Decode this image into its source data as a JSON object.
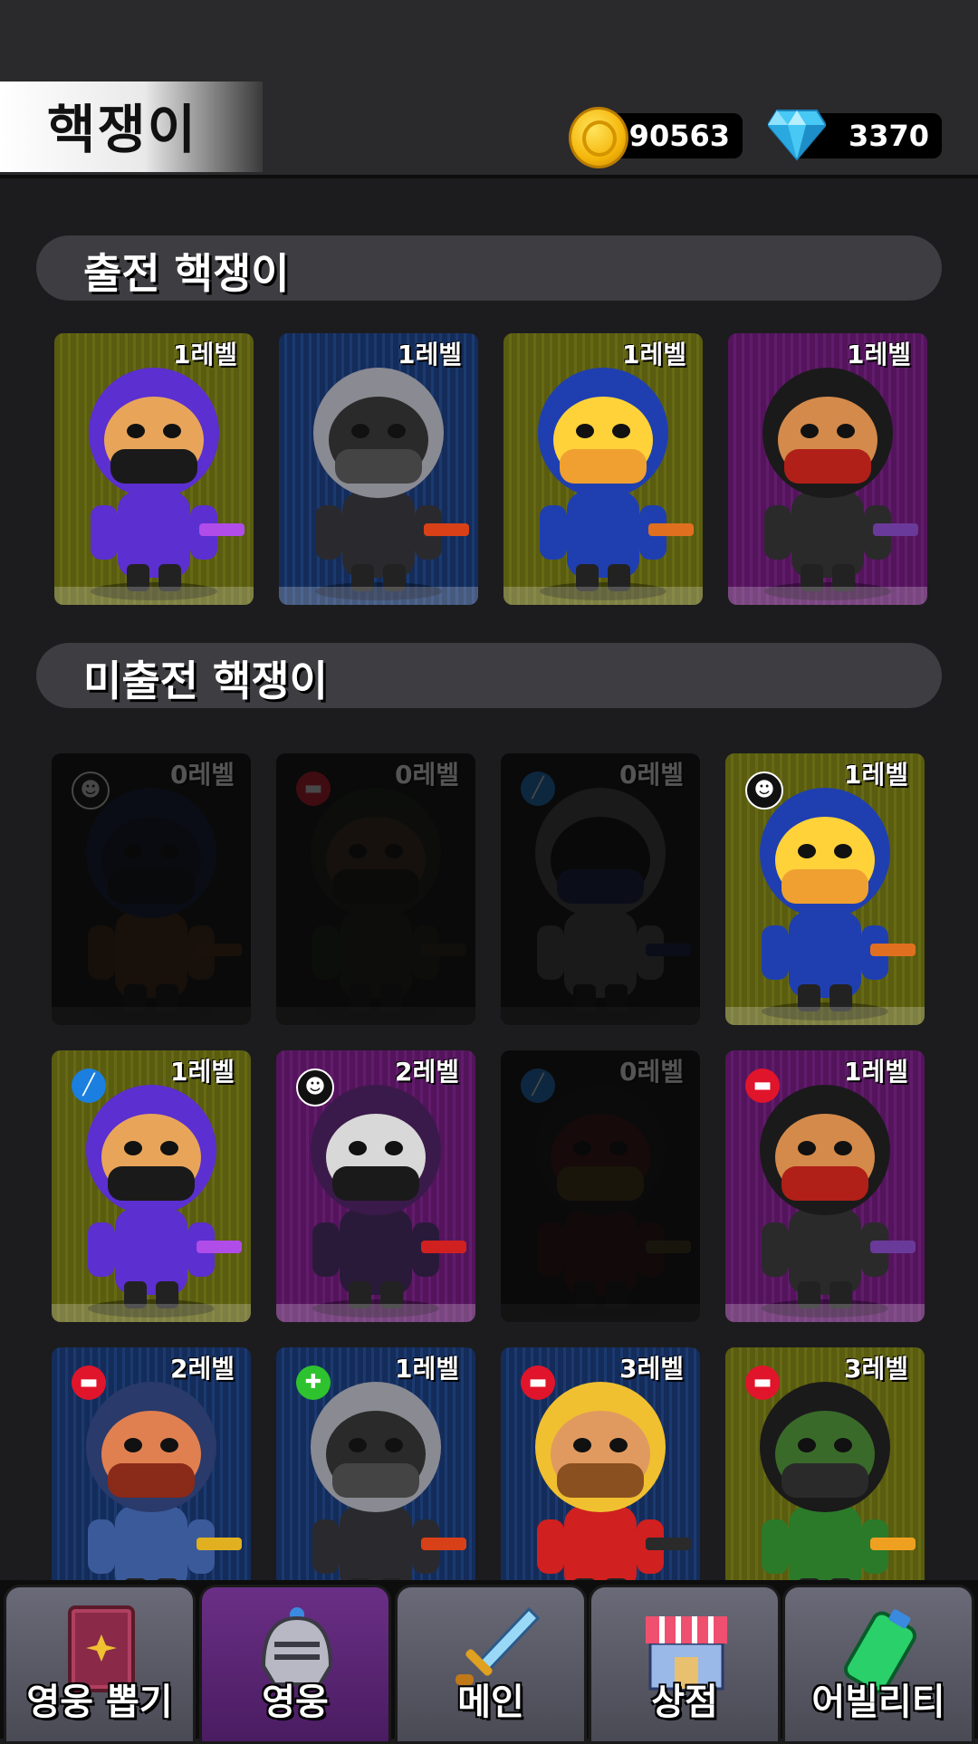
{
  "header": {
    "title": "핵쟁이",
    "gold": "90563",
    "gems": "3370",
    "gold_icon": "gold-coin-icon",
    "gem_icon": "diamond-icon"
  },
  "sections": {
    "deployed_title": "출전 핵쟁이",
    "undeployed_title": "미출전 핵쟁이"
  },
  "deployed": [
    {
      "level": "1레벨",
      "hero": "ninja",
      "bg": "olive"
    },
    {
      "level": "1레벨",
      "hero": "knight",
      "bg": "navy"
    },
    {
      "level": "1레벨",
      "hero": "robot",
      "bg": "olive"
    },
    {
      "level": "1레벨",
      "hero": "commando",
      "bg": "purple"
    }
  ],
  "undeployed": [
    {
      "level": "0레벨",
      "hero": "alien",
      "badge": "alien",
      "locked": true
    },
    {
      "level": "0레벨",
      "hero": "soldier",
      "badge": "gun",
      "locked": true
    },
    {
      "level": "0레벨",
      "hero": "astronaut",
      "badge": "wrench",
      "locked": true
    },
    {
      "level": "1레벨",
      "hero": "robot",
      "badge": "alien",
      "locked": false,
      "bg": "olive"
    },
    {
      "level": "1레벨",
      "hero": "ninja",
      "badge": "wrench",
      "locked": false,
      "bg": "olive"
    },
    {
      "level": "2레벨",
      "hero": "masked",
      "badge": "alien",
      "locked": false,
      "bg": "purple"
    },
    {
      "level": "0레벨",
      "hero": "samurai",
      "badge": "wrench",
      "locked": true
    },
    {
      "level": "1레벨",
      "hero": "commando",
      "badge": "gun",
      "locked": false,
      "bg": "purple"
    },
    {
      "level": "2레벨",
      "hero": "sheriff",
      "badge": "gun",
      "locked": false,
      "bg": "navy"
    },
    {
      "level": "1레벨",
      "hero": "knight",
      "badge": "heal",
      "locked": false,
      "bg": "navy"
    },
    {
      "level": "3레벨",
      "hero": "blond",
      "badge": "gun",
      "locked": false,
      "bg": "navy"
    },
    {
      "level": "3레벨",
      "hero": "gasmask",
      "badge": "gun",
      "locked": false,
      "bg": "olive"
    }
  ],
  "nav": [
    {
      "label": "영웅 뽑기",
      "icon": "spellbook-icon",
      "active": false
    },
    {
      "label": "영웅",
      "icon": "helmet-icon",
      "active": true
    },
    {
      "label": "메인",
      "icon": "sword-icon",
      "active": false
    },
    {
      "label": "상점",
      "icon": "shop-icon",
      "active": false
    },
    {
      "label": "어빌리티",
      "icon": "battery-icon",
      "active": false
    }
  ]
}
